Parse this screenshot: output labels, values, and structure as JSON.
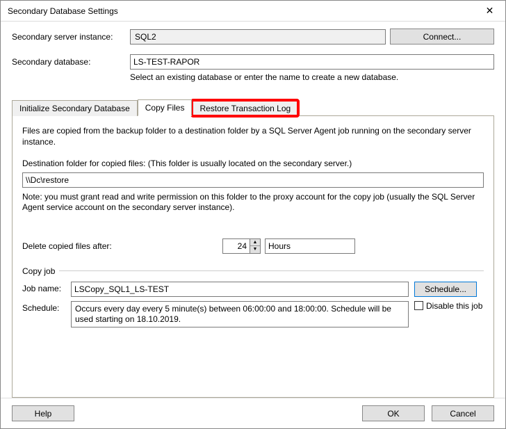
{
  "window": {
    "title": "Secondary Database Settings",
    "close_glyph": "✕"
  },
  "form": {
    "server_label": "Secondary server instance:",
    "server_value": "SQL2",
    "connect_label": "Connect...",
    "db_label": "Secondary database:",
    "db_value": "LS-TEST-RAPOR",
    "db_help": "Select an existing database or enter the name to create a new database."
  },
  "tabs": {
    "init": "Initialize Secondary Database",
    "copy": "Copy Files",
    "restore": "Restore Transaction Log"
  },
  "panel": {
    "intro": "Files are copied from the backup folder to a destination folder by a SQL Server Agent job running on the secondary server instance.",
    "dest_label": "Destination folder for copied files: (This folder is usually located on the secondary server.)",
    "dest_value": "\\\\Dc\\restore",
    "note": "Note: you must grant read and write permission on this folder to the proxy account for the copy job (usually the SQL Server Agent service account on the secondary server instance).",
    "delete_label": "Delete copied files after:",
    "delete_value": "24",
    "delete_unit": "Hours",
    "copyjob_header": "Copy job",
    "jobname_label": "Job name:",
    "jobname_value": "LSCopy_SQL1_LS-TEST",
    "schedule_btn": "Schedule...",
    "schedule_label": "Schedule:",
    "schedule_value": "Occurs every day every 5 minute(s) between 06:00:00 and 18:00:00. Schedule will be used starting on 18.10.2019.",
    "disable_label": "Disable this job"
  },
  "footer": {
    "help": "Help",
    "ok": "OK",
    "cancel": "Cancel"
  }
}
